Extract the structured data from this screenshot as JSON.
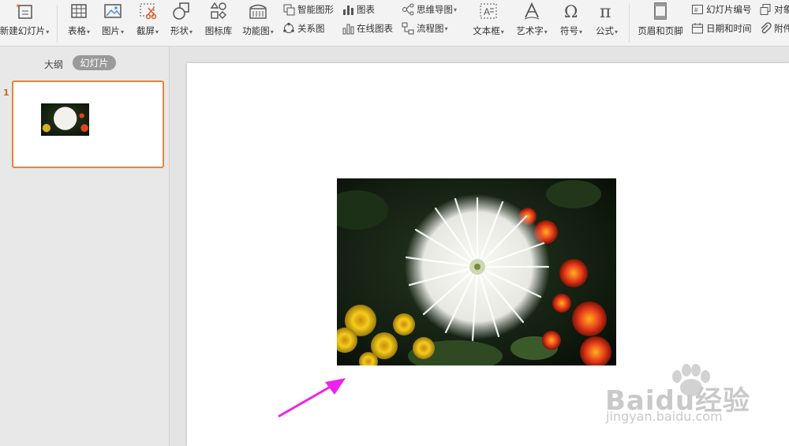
{
  "ribbon": {
    "new_slide": "新建幻灯片",
    "table": "表格",
    "picture": "图片",
    "screenshot": "截屏",
    "shapes": "形状",
    "icon_library": "图标库",
    "function_diagram": "功能图",
    "smart_art": "智能图形",
    "chart": "图表",
    "mind_map": "思维导图",
    "relation_diagram": "关系图",
    "online_chart": "在线图表",
    "flowchart": "流程图",
    "text_box": "文本框",
    "word_art": "艺术字",
    "symbol": "符号",
    "formula": "公式",
    "header_footer": "页眉和页脚",
    "slide_number": "幻灯片编号",
    "date_time": "日期和时间",
    "object": "对象",
    "attachment": "附件",
    "dropdown_glyph": "▾"
  },
  "left_panel": {
    "tab_outline": "大纲",
    "tab_slides": "幻灯片",
    "slides": [
      {
        "number": "1"
      }
    ]
  },
  "watermark": {
    "brand": "Baidu经验",
    "url": "jingyan.baidu.com"
  },
  "colors": {
    "accent_orange": "#e2843f",
    "arrow_magenta": "#ee22ee",
    "ribbon_bg": "#f3f3f3"
  }
}
